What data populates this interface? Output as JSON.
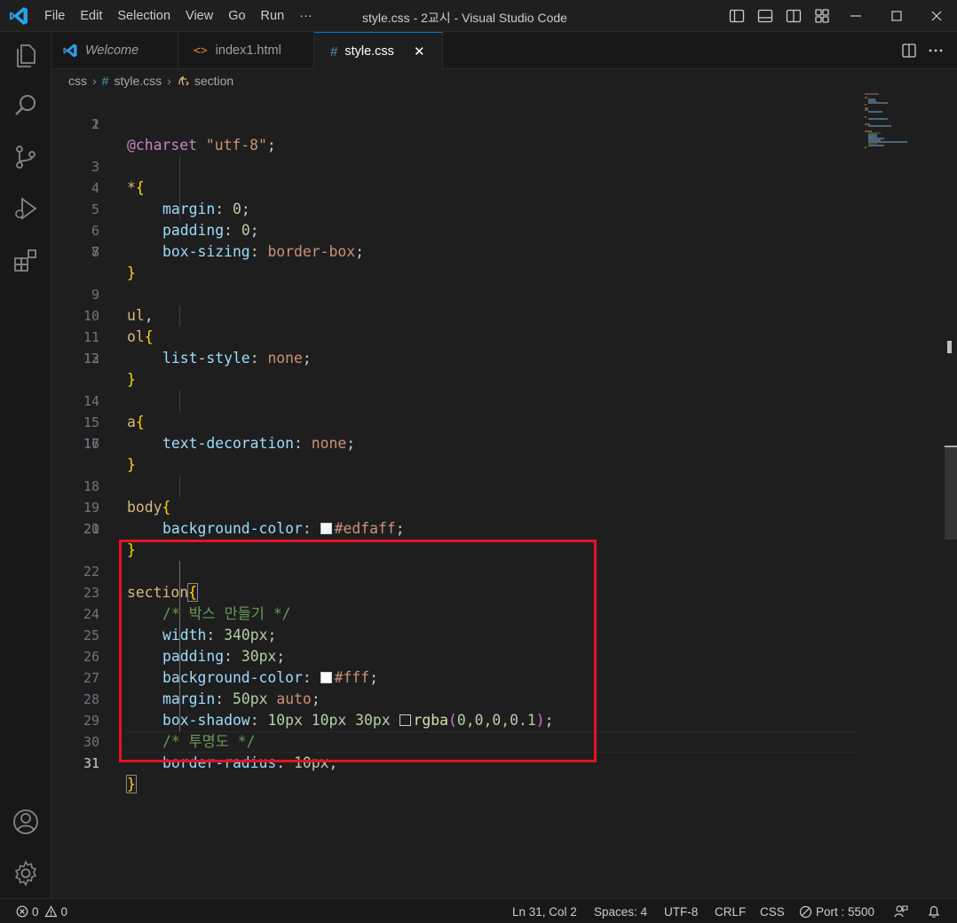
{
  "titlebar": {
    "menu": [
      "File",
      "Edit",
      "Selection",
      "View",
      "Go",
      "Run",
      "···"
    ],
    "title": "style.css - 2교시 - Visual Studio Code"
  },
  "tabs": [
    {
      "label": "Welcome",
      "icon": "vscode-icon",
      "active": false
    },
    {
      "label": "index1.html",
      "icon": "html-icon",
      "active": false
    },
    {
      "label": "style.css",
      "icon": "css-hash-icon",
      "active": true,
      "close": "✕"
    }
  ],
  "breadcrumb": {
    "folder": "css",
    "file": "style.css",
    "symbol": "section"
  },
  "code": {
    "charset_kw": "@charset",
    "charset_val": "\"utf-8\"",
    "semi": ";",
    "star": "*",
    "ob": "{",
    "cb": "}",
    "colon": ": ",
    "comma": ",",
    "margin": "margin",
    "padding": "padding",
    "zero": "0",
    "box_sizing": "box-sizing",
    "border_box": "border-box",
    "ul": "ul",
    "ol": "ol",
    "list_style": "list-style",
    "none": "none",
    "a": "a",
    "text_decoration": "text-decoration",
    "body": "body",
    "background_color": "background-color",
    "edfaff": "#edfaff",
    "section": "section",
    "comment_box": "/* 박스 만들기 */",
    "width": "width",
    "px340": "340px",
    "px30": "30px",
    "fff": "#fff",
    "px50": "50px",
    "auto": "auto",
    "box_shadow": "box-shadow",
    "px10": "10px",
    "sp": " ",
    "rgba": "rgba",
    "lp": "(",
    "rp": ")",
    "rgba_args": "0,0,0,0.1",
    "comment_opacity": "/* 투명도 */",
    "border_radius": "border-radius"
  },
  "line_numbers": [
    "1",
    "2",
    "3",
    "4",
    "5",
    "6",
    "7",
    "8",
    "9",
    "10",
    "11",
    "12",
    "13",
    "14",
    "15",
    "16",
    "17",
    "18",
    "19",
    "20",
    "21",
    "22",
    "23",
    "24",
    "25",
    "26",
    "27",
    "28",
    "29",
    "30",
    "31"
  ],
  "colors": {
    "swatch_edfaff": "#edfaff",
    "swatch_fff": "#ffffff",
    "swatch_rgba": "rgba(0,0,0,0.1)",
    "highlight_box": "#e81123",
    "accent": "#0078d4"
  },
  "status": {
    "errors": "0",
    "warnings": "0",
    "position": "Ln 31, Col 2",
    "spaces": "Spaces: 4",
    "encoding": "UTF-8",
    "eol": "CRLF",
    "language": "CSS",
    "port": "Port : 5500"
  }
}
